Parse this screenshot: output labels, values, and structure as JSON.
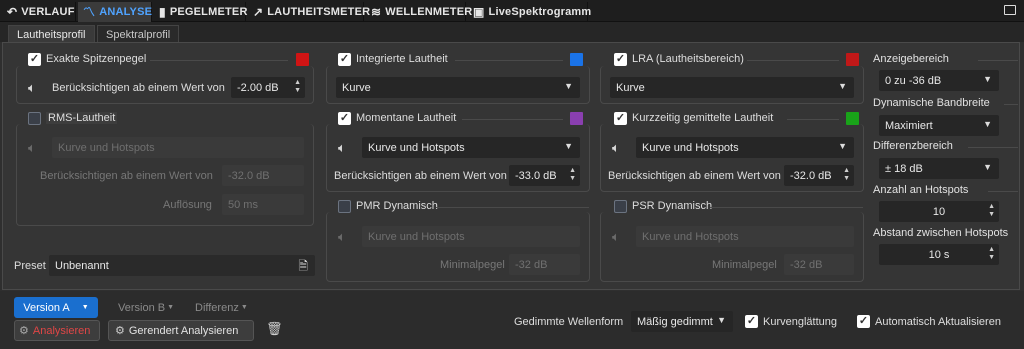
{
  "tabs": [
    {
      "label": "VERLAUF",
      "icon": "undo-icon"
    },
    {
      "label": "ANALYSE",
      "icon": "analyse-icon"
    },
    {
      "label": "PEGELMETER",
      "icon": "bars-icon"
    },
    {
      "label": "LAUTHEITSMETER",
      "icon": "arrow-icon"
    },
    {
      "label": "WELLENMETER",
      "icon": "wave-icon"
    },
    {
      "label": "LiveSpektrogramm",
      "icon": "image-icon"
    }
  ],
  "subtabs": [
    "Lautheitsprofil",
    "Spektralprofil"
  ],
  "col1": {
    "exakte_label": "Exakte Spitzenpegel",
    "exakte_checked": true,
    "exakte_color": "#d01414",
    "exakte_consider": "Berücksichtigen ab einem Wert von",
    "exakte_value": "-2.00 dB",
    "rms_label": "RMS-Lautheit",
    "rms_checked": false,
    "rms_mode": "Kurve und Hotspots",
    "rms_consider": "Berücksichtigen ab einem Wert von",
    "rms_value": "-32.0 dB",
    "rms_res_label": "Auflösung",
    "rms_res_value": "50 ms",
    "preset_label": "Preset",
    "preset_value": "Unbenannt"
  },
  "col2": {
    "int_label": "Integrierte Lautheit",
    "int_checked": true,
    "int_color": "#1a73e8",
    "int_mode": "Kurve",
    "mom_label": "Momentane Lautheit",
    "mom_checked": true,
    "mom_color": "#8a3fb0",
    "mom_mode": "Kurve und Hotspots",
    "mom_consider": "Berücksichtigen ab einem Wert von",
    "mom_value": "-33.0 dB",
    "pmr_label": "PMR Dynamisch",
    "pmr_checked": false,
    "pmr_mode": "Kurve und Hotspots",
    "pmr_min_label": "Minimalpegel",
    "pmr_min_value": "-32 dB"
  },
  "col3": {
    "lra_label": "LRA (Lautheitsbereich)",
    "lra_checked": true,
    "lra_color": "#c01818",
    "lra_mode": "Kurve",
    "short_label": "Kurzzeitig gemittelte Lautheit",
    "short_checked": true,
    "short_color": "#19a319",
    "short_mode": "Kurve und Hotspots",
    "short_consider": "Berücksichtigen ab einem Wert von",
    "short_value": "-32.0 dB",
    "psr_label": "PSR Dynamisch",
    "psr_checked": false,
    "psr_mode": "Kurve und Hotspots",
    "psr_min_label": "Minimalpegel",
    "psr_min_value": "-32 dB"
  },
  "right": {
    "range_label": "Anzeigebereich",
    "range_value": "0 zu -36 dB",
    "dyn_label": "Dynamische Bandbreite",
    "dyn_value": "Maximiert",
    "diff_label": "Differenzbereich",
    "diff_value": "± 18 dB",
    "hot_label": "Anzahl an Hotspots",
    "hot_value": "10",
    "dist_label": "Abstand zwischen Hotspots",
    "dist_value": "10 s"
  },
  "bottom": {
    "version_a": "Version A",
    "version_b": "Version B",
    "diff": "Differenz",
    "analyze": "Analysieren",
    "render_analyze": "Gerendert Analysieren",
    "wave_label": "Gedimmte Wellenform",
    "wave_value": "Mäßig gedimmt",
    "smooth_label": "Kurvenglättung",
    "smooth_checked": true,
    "auto_label": "Automatisch Aktualisieren",
    "auto_checked": true
  },
  "colors": {
    "accent": "#4fa3ff",
    "primary_button": "#1a6fcf",
    "analyze_text": "#e04646"
  }
}
